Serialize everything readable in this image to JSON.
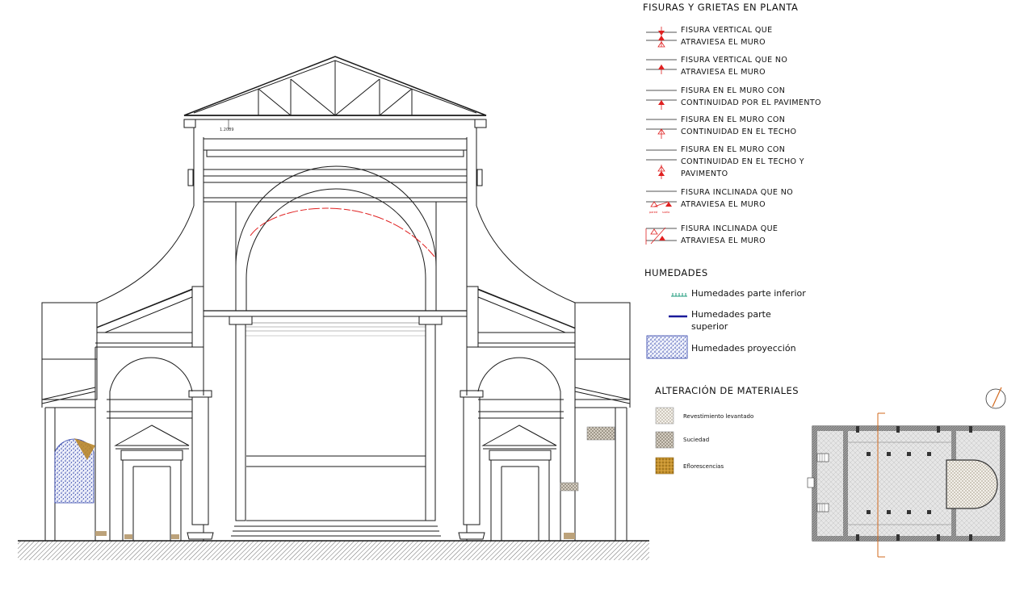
{
  "legend": {
    "fisuras_title": "FISURAS Y GRIETAS EN PLANTA",
    "fisuras": [
      {
        "line1": "FISURA VERTICAL QUE",
        "line2": "ATRAVIESA EL MURO",
        "line3": ""
      },
      {
        "line1": "FISURA VERTICAL QUE NO",
        "line2": "ATRAVIESA EL MURO",
        "line3": ""
      },
      {
        "line1": "FISURA EN EL MURO CON",
        "line2": "CONTINUIDAD POR EL PAVIMENTO",
        "line3": ""
      },
      {
        "line1": "FISURA EN EL MURO CON",
        "line2": "CONTINUIDAD EN EL TECHO",
        "line3": ""
      },
      {
        "line1": "FISURA EN EL MURO CON",
        "line2": "CONTINUIDAD EN EL TECHO Y",
        "line3": "PAVIMENTO"
      },
      {
        "line1": "FISURA INCLINADA QUE NO",
        "line2": "ATRAVIESA EL MURO",
        "line3": ""
      },
      {
        "line1": "FISURA INCLINADA QUE",
        "line2": "ATRAVIESA EL MURO",
        "line3": ""
      }
    ],
    "humedades_title": "HUMEDADES",
    "humedades": [
      {
        "line1": "Humedades parte inferior",
        "line2": ""
      },
      {
        "line1": "Humedades parte",
        "line2": "superior"
      },
      {
        "line1": "Humedades proyección",
        "line2": ""
      }
    ],
    "materiales_title": "ALTERACIÓN DE MATERIALES",
    "materiales": [
      {
        "label": "Revestimiento levantado"
      },
      {
        "label": "Suciedad"
      },
      {
        "label": "Eflorescencias"
      }
    ]
  },
  "drawing": {
    "dimension_label": "1.2089"
  },
  "colors": {
    "line": "#1a1a1a",
    "crack": "#e02020",
    "humedad_inferior": "#1a9a7a",
    "humedad_superior": "#1a1a9a",
    "humedad_proyeccion": "#3b4fb0",
    "eflorescencias": "#b8862a",
    "section_cut": "#d2691e"
  }
}
